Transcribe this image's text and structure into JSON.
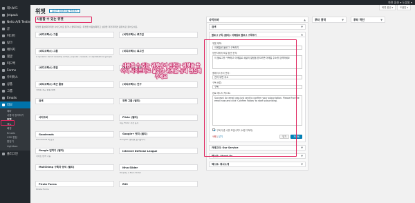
{
  "adminbar": {
    "right_label": "화면 옵션 ▾   도움말 ▾"
  },
  "sidebar": {
    "items": [
      {
        "label": "대시보드",
        "icon": "dashboard-icon"
      },
      {
        "label": "Jetpack",
        "icon": "jetpack-icon"
      },
      {
        "label": "Nelio A/B Testing",
        "icon": "nelio-icon"
      },
      {
        "label": "글",
        "icon": "posts-icon"
      },
      {
        "label": "미디어",
        "icon": "media-icon"
      },
      {
        "label": "링크",
        "icon": "links-icon"
      },
      {
        "label": "페이지",
        "icon": "pages-icon"
      },
      {
        "label": "댓글",
        "icon": "comments-icon"
      },
      {
        "label": "피드백",
        "icon": "feedback-icon"
      },
      {
        "label": "Forms",
        "icon": "forms-icon"
      },
      {
        "label": "우커머스",
        "icon": "woocommerce-icon"
      },
      {
        "label": "상품",
        "icon": "products-icon"
      },
      {
        "label": "그룹",
        "icon": "groups-icon"
      },
      {
        "label": "Emails",
        "icon": "emails-icon"
      },
      {
        "label": "외모",
        "icon": "appearance-icon"
      }
    ],
    "submenu": [
      "테마",
      "사용자 정의하기",
      "위젯",
      "메뉴",
      "배경",
      "Emails",
      "CSS 편집",
      "편집기",
      "Lightbox"
    ],
    "bottom": {
      "label": "플러그인",
      "icon": "plugins-icon"
    }
  },
  "header": {
    "title": "위젯",
    "manage_button": "실시간 미리보기로 관리하기"
  },
  "available": {
    "title": "사용할 수 있는 위젯",
    "description": "위젯을 활성화하려면 사이드바로 끌거나 클릭하세요. 위젯을 비활성화하고 설정을 제거하려면 원위치로 끌어오세요.",
    "widgets": [
      {
        "name": "(비디오팩스) 그룹",
        "desc": ""
      },
      {
        "name": "(비디오팩스) 로그인",
        "desc": ""
      },
      {
        "name": "(비디오팩스) 그룹",
        "desc": "A dynamic list of recently active, popular, newest, or alphabetical groups"
      },
      {
        "name": "(비디오팩스) 로그인",
        "desc": ""
      },
      {
        "name": "(비디오팩스) 회원",
        "desc": ""
      },
      {
        "name": "(비디오팩스) 친구",
        "desc": ""
      },
      {
        "name": "(비디오팩스) 최근 활동",
        "desc": "사이트 최근 활동 목록"
      },
      {
        "name": "(비디오팩스) 친구",
        "desc": ""
      },
      {
        "name": "검색",
        "desc": ""
      },
      {
        "name": "위젯 그룹 (멀티)",
        "desc": ""
      },
      {
        "name": "사이드바",
        "desc": ""
      },
      {
        "name": "Flickr (멀티)",
        "desc": "최근 Flickr 사진 표시"
      },
      {
        "name": "Goodreads",
        "desc": "Goodreads 책 표시"
      },
      {
        "name": "Google+ 뱃지 (멀티)",
        "desc": "Google+ 뱃지를 표시합니다"
      },
      {
        "name": "Google 번역기 (멀티)",
        "desc": "사이트 번역 기능"
      },
      {
        "name": "Internet Defense League",
        "desc": ""
      },
      {
        "name": "MailChimp 구독자 양식 (멀티)",
        "desc": ""
      },
      {
        "name": "Nivo Slider",
        "desc": "Display a Nivo Slider"
      },
      {
        "name": "Pirate Forms",
        "desc": "Pirate Forms"
      },
      {
        "name": "RSS",
        "desc": ""
      }
    ]
  },
  "annotation": "사용할 수 있는 위젯에서 원하는 위젯을 끌어서 사이드바로 옮기고 위젯을 상세 편집해주세요",
  "sidebar_area": {
    "title": "사이드바",
    "top_widget": "검색",
    "open_widget": {
      "title": "블로그 구독 (멀티): 이메일로 블로그 구독하기",
      "fields": [
        {
          "label": "위젯 제목:",
          "value": "이메일로 블로그 구독하기"
        },
        {
          "label": "방문자에게 보일 옵션 문자:",
          "value": "이 블로그를 구독하고 이메일로 새글의 알림을 받으려면 이메일 주소를 입력하세요"
        },
        {
          "label": "플레이스홀더 문자:",
          "value": "전자 우편 주소"
        },
        {
          "label": "구독 버튼:",
          "value": "구독"
        },
        {
          "label": "완료 메시지 텍스트:",
          "value": "Success! An email was just sent to confirm your subscription. Please find the email now and click 'Confirm Follow' to start subscribing."
        }
      ],
      "checkbox_label": "구독자 총 수를 보입니까? (N명 구독자)",
      "delete": "삭제",
      "close": "닫기",
      "saved": "저장됨"
    },
    "more_widgets": [
      "카테고리: Our Service",
      "텍스트: About Us",
      "텍스트: 회사소개"
    ]
  },
  "footer_area": {
    "title": "푸터 영역"
  },
  "footer_bottom": {
    "title": "푸터 하단"
  }
}
